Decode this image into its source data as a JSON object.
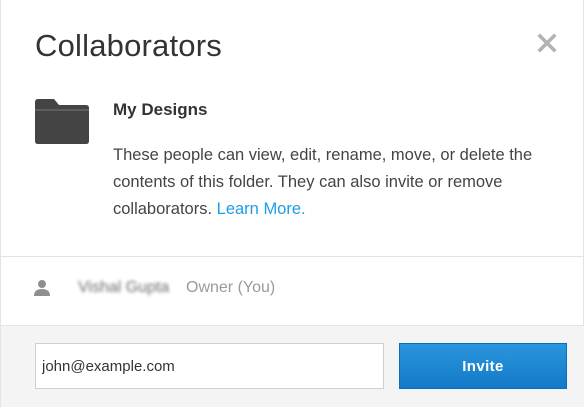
{
  "dialog": {
    "title": "Collaborators",
    "close_icon": "close-icon"
  },
  "folder": {
    "icon": "folder-icon",
    "name": "My Designs",
    "description": "These people can view, edit, rename, move, or delete the contents of this folder. They can also invite or remove collaborators.",
    "learn_more_label": "Learn More."
  },
  "collaborators": [
    {
      "icon": "person-icon",
      "name": "Vishal Gupta",
      "role": "Owner (You)"
    }
  ],
  "invite": {
    "email_value": "john@example.com",
    "button_label": "Invite"
  },
  "colors": {
    "accent": "#1a9ee6",
    "button": "#1379c8",
    "folder": "#4a4a4a"
  }
}
